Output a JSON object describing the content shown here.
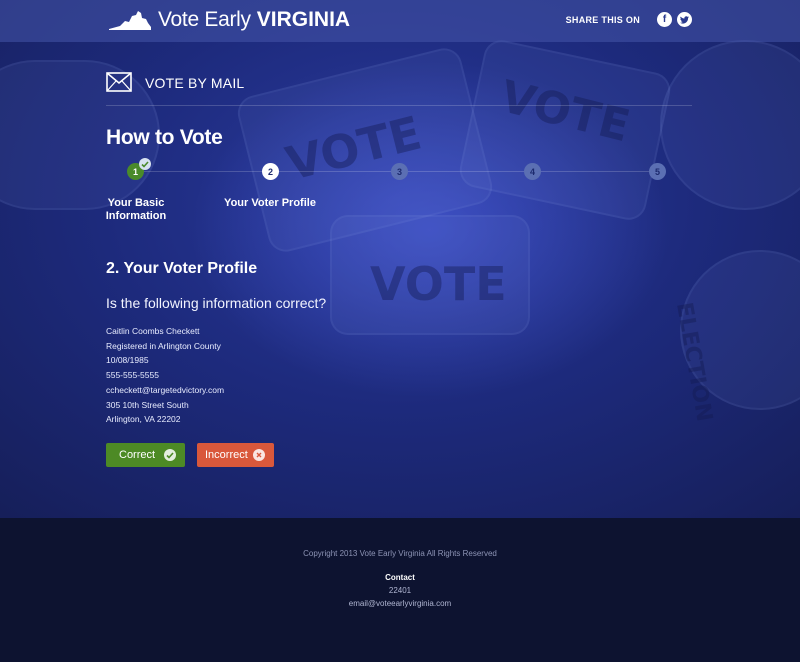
{
  "header": {
    "logo_light": "Vote Early",
    "logo_bold": "VIRGINIA",
    "share_label": "SHARE THIS ON",
    "social": [
      {
        "name": "facebook-icon",
        "glyph": "f"
      },
      {
        "name": "twitter-icon",
        "glyph": "t"
      }
    ]
  },
  "section": {
    "icon": "envelope-icon",
    "title": "VOTE BY MAIL"
  },
  "how_to_vote": "How to Vote",
  "steps": [
    {
      "number": "1",
      "label": "Your Basic Information",
      "state": "done"
    },
    {
      "number": "2",
      "label": "Your Voter Profile",
      "state": "current"
    },
    {
      "number": "3",
      "label": "",
      "state": "todo"
    },
    {
      "number": "4",
      "label": "",
      "state": "todo"
    },
    {
      "number": "5",
      "label": "",
      "state": "todo"
    }
  ],
  "profile": {
    "title": "2. Your Voter Profile",
    "question": "Is the following information correct?",
    "lines": [
      "Caitlin Coombs Checkett",
      "Registered in Arlington County",
      "10/08/1985",
      "555-555-5555",
      "ccheckett@targetedvictory.com",
      "305 10th Street South",
      "Arlington, VA 22202"
    ]
  },
  "buttons": {
    "correct": "Correct",
    "incorrect": "Incorrect"
  },
  "colors": {
    "accent_green": "#4d8a25",
    "accent_red": "#d9583b",
    "hero_blue": "#1d2a7c",
    "footer_bg": "#0d1330"
  },
  "footer": {
    "copyright": "Copyright 2013 Vote Early Virginia All Rights Reserved",
    "contact_heading": "Contact",
    "zip": "22401",
    "email": "email@voteearlyvirginia.com"
  }
}
